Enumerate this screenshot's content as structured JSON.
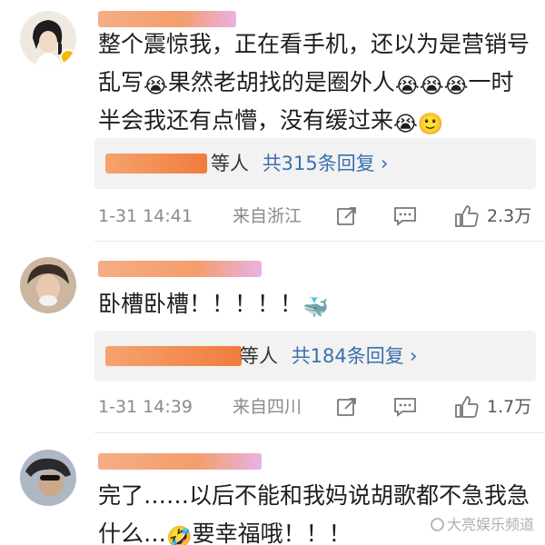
{
  "comments": [
    {
      "text_parts": [
        "整个震惊我，正在看手机，还以为是营销号乱写",
        "😭",
        "果然老胡找的是圈外人",
        "😭😭😭",
        "一时半会我还有点懵，没有缓过来",
        "😭🙂"
      ],
      "reply_suffix": "等人",
      "reply_count": "共315条回复",
      "reply_chevron": "›",
      "time": "1-31 14:41",
      "location": "来自浙江",
      "likes": "2.3万"
    },
    {
      "text_parts": [
        "卧槽卧槽！！！！！",
        "🐳"
      ],
      "reply_suffix": "等人",
      "reply_count": "共184条回复",
      "reply_chevron": "›",
      "time": "1-31 14:39",
      "location": "来自四川",
      "likes": "1.7万"
    },
    {
      "text_parts": [
        "完了……以后不能和我妈说胡歌都不急我急什么…",
        "🤣",
        "要幸福哦！！！"
      ]
    }
  ],
  "watermark": "大亮娱乐频道",
  "icons": [
    "share-icon",
    "comment-icon",
    "like-icon",
    "verified-badge-icon",
    "emoji-icon"
  ]
}
